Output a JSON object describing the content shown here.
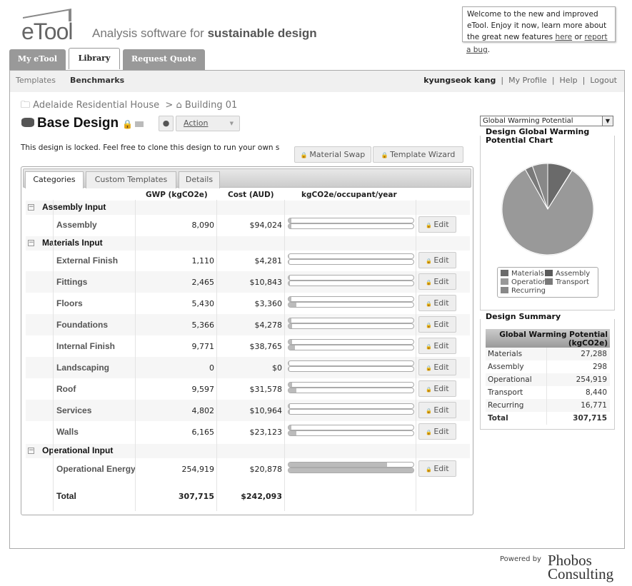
{
  "brand": {
    "logo": "eTool",
    "tagline_plain": "Analysis software for ",
    "tagline_bold": "sustainable design"
  },
  "welcome": {
    "text": "Welcome to the new and improved eTool. Enjoy it now, learn more about the great new features ",
    "here": "here",
    "or": " or ",
    "report": "report",
    "bug": "a bug",
    "period": "."
  },
  "tabs": [
    {
      "label": "My eTool"
    },
    {
      "label": "Library"
    },
    {
      "label": "Request Quote"
    }
  ],
  "subnav": {
    "templates": "Templates",
    "benchmarks": "Benchmarks"
  },
  "user": {
    "name": "kyungseok kang",
    "profile": "My Profile",
    "help": "Help",
    "logout": "Logout",
    "sep": "|"
  },
  "breadcrumb": {
    "project": "Adelaide Residential House",
    "sep": ">",
    "building": "Building 01"
  },
  "design": {
    "title": "Base Design",
    "action": "Action",
    "locked_msg": "This design is locked. Feel free to clone this design to run your own s",
    "material_swap": "Material Swap",
    "template_wizard": "Template Wizard"
  },
  "inner_tabs": [
    {
      "label": "Categories"
    },
    {
      "label": "Custom Templates"
    },
    {
      "label": "Details"
    }
  ],
  "columns": {
    "gwp": "GWP (kgCO2e)",
    "cost": "Cost (AUD)",
    "bar": "kgCO2e/occupant/year"
  },
  "edit_label": "Edit",
  "groups": [
    {
      "name": "Assembly Input",
      "rows": [
        {
          "name": "Assembly",
          "gwp": "8,090",
          "cost": "$94,024",
          "gwp_pct": 2,
          "cost_pct": 2
        }
      ]
    },
    {
      "name": "Materials Input",
      "rows": [
        {
          "name": "External Finish",
          "gwp": "1,110",
          "cost": "$4,281",
          "gwp_pct": 0.5,
          "cost_pct": 0.5
        },
        {
          "name": "Fittings",
          "gwp": "2,465",
          "cost": "$10,843",
          "gwp_pct": 1,
          "cost_pct": 1
        },
        {
          "name": "Floors",
          "gwp": "5,430",
          "cost": "$3,360",
          "gwp_pct": 2,
          "cost_pct": 6
        },
        {
          "name": "Foundations",
          "gwp": "5,366",
          "cost": "$4,278",
          "gwp_pct": 2,
          "cost_pct": 3
        },
        {
          "name": "Internal Finish",
          "gwp": "9,771",
          "cost": "$38,765",
          "gwp_pct": 3,
          "cost_pct": 5
        },
        {
          "name": "Landscaping",
          "gwp": "0",
          "cost": "$0",
          "gwp_pct": 0,
          "cost_pct": 0
        },
        {
          "name": "Roof",
          "gwp": "9,597",
          "cost": "$31,578",
          "gwp_pct": 3,
          "cost_pct": 6
        },
        {
          "name": "Services",
          "gwp": "4,802",
          "cost": "$10,964",
          "gwp_pct": 1,
          "cost_pct": 1
        },
        {
          "name": "Walls",
          "gwp": "6,165",
          "cost": "$23,123",
          "gwp_pct": 2,
          "cost_pct": 6
        }
      ]
    },
    {
      "name": "Operational Input",
      "rows": [
        {
          "name": "Operational Energy",
          "gwp": "254,919",
          "cost": "$20,878",
          "gwp_pct": 79,
          "cost_pct": 100
        }
      ]
    }
  ],
  "total": {
    "label": "Total",
    "gwp": "307,715",
    "cost": "$242,093"
  },
  "side": {
    "selector": "Global Warming Potential",
    "chart_title": "Design Global Warming Potential Chart",
    "summary_title": "Design Summary",
    "summary_header": "Global Warming Potential (kgCO2e)"
  },
  "chart_data": {
    "type": "pie",
    "title": "Design Global Warming Potential Chart",
    "legend_placement": "bottom",
    "slices": [
      {
        "name": "Materials",
        "value": 27288,
        "color": "#6a6a6a"
      },
      {
        "name": "Assembly",
        "value": 298,
        "color": "#5a5a5a"
      },
      {
        "name": "Operational",
        "value": 254919,
        "color": "#999999"
      },
      {
        "name": "Transport",
        "value": 8440,
        "color": "#7a7a7a"
      },
      {
        "name": "Recurring",
        "value": 16771,
        "color": "#888888"
      }
    ]
  },
  "summary": [
    {
      "label": "Materials",
      "value": "27,288"
    },
    {
      "label": "Assembly",
      "value": "298"
    },
    {
      "label": "Operational",
      "value": "254,919"
    },
    {
      "label": "Transport",
      "value": "8,440"
    },
    {
      "label": "Recurring",
      "value": "16,771"
    },
    {
      "label": "Total",
      "value": "307,715"
    }
  ],
  "footer": {
    "powered": "Powered by",
    "company1": "Phobos",
    "company2": "Consulting"
  }
}
